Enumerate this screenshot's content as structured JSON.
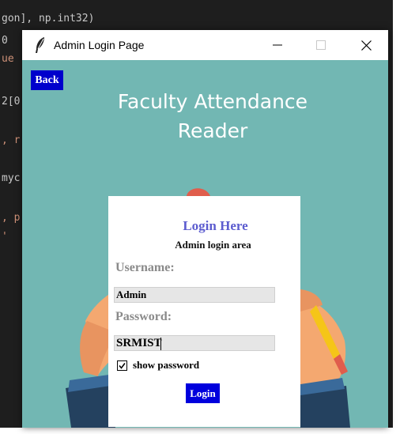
{
  "background_editor": {
    "lines": [
      "gon], np.int32)",
      "0",
      "ue",
      "2[0",
      ", r",
      "myc",
      ", p",
      "' "
    ]
  },
  "window": {
    "title": "Admin Login Page",
    "icon": "feather-icon",
    "controls": {
      "minimize": "minimize-icon",
      "maximize": "maximize-icon",
      "close": "close-icon"
    }
  },
  "page": {
    "back_label": "Back",
    "title": "Faculty Attendance Reader",
    "background_color": "#72b7b3"
  },
  "login": {
    "heading": "Login Here",
    "subheading": "Admin login area",
    "username_label": "Username:",
    "username_value": "Admin",
    "password_label": "Password:",
    "password_value": "SRMIST",
    "show_password_label": "show password",
    "show_password_checked": true,
    "login_label": "Login",
    "button_color": "#0000dd",
    "heading_color": "#5c5ccf"
  }
}
